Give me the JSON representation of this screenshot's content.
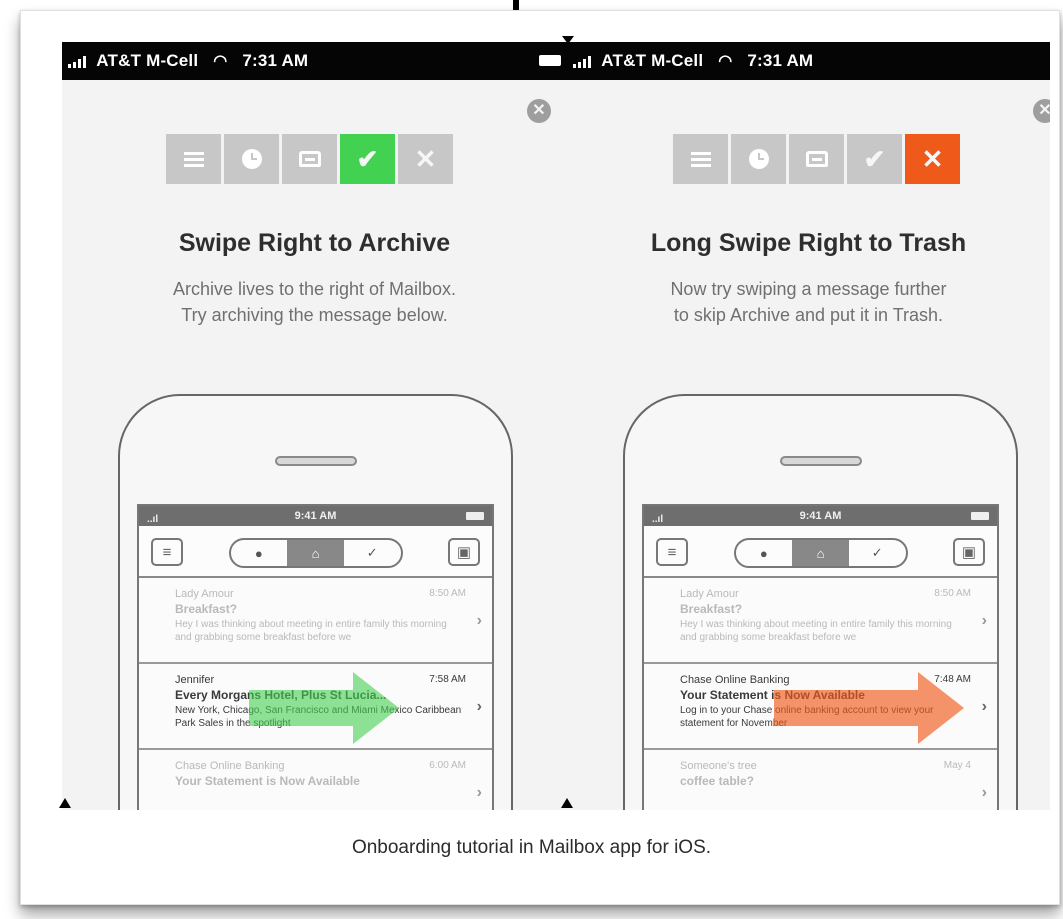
{
  "caption": "Onboarding tutorial in Mailbox app for iOS.",
  "status_bar": {
    "carrier": "AT&T M-Cell",
    "time": "7:31 AM"
  },
  "screens": [
    {
      "title": "Swipe Right to Archive",
      "line1": "Archive lives to the right of Mailbox.",
      "line2": "Try archiving the message below.",
      "active_action": "archive",
      "accent": "#43d151"
    },
    {
      "title": "Long Swipe Right to Trash",
      "line1": "Now try swiping a message further",
      "line2": "to skip Archive and put it in Trash.",
      "active_action": "trash",
      "accent": "#ef5a1b"
    }
  ],
  "icons": [
    "list-icon",
    "clock-icon",
    "inbox-icon",
    "check-icon",
    "x-icon",
    "close-icon"
  ],
  "phone": {
    "time": "9:41 AM",
    "left": {
      "msg1": {
        "from": "Lady Amour",
        "time": "8:50 AM",
        "subject": "Breakfast?",
        "preview": "Hey I was thinking about meeting in entire family this morning and grabbing some breakfast before we"
      },
      "msg2": {
        "from": "Jennifer",
        "time": "7:58 AM",
        "subject": "Every Morgans Hotel, Plus St Lucia...",
        "preview": "New York, Chicago, San Francisco and Miami Mexico Caribbean Park Sales in the spotlight"
      },
      "msg3": {
        "from": "Chase Online Banking",
        "time": "6:00 AM",
        "subject": "Your Statement is Now Available",
        "preview": ""
      }
    },
    "right": {
      "msg1": {
        "from": "Lady Amour",
        "time": "8:50 AM",
        "subject": "Breakfast?",
        "preview": "Hey I was thinking about meeting in entire family this morning and grabbing some breakfast before we"
      },
      "msg2": {
        "from": "Chase Online Banking",
        "time": "7:48 AM",
        "subject": "Your Statement is Now Available",
        "preview": "Log in to your Chase online banking account to view your statement for November"
      },
      "msg3": {
        "from": "Someone's tree",
        "time": "May 4",
        "subject": "coffee table?",
        "preview": ""
      }
    }
  }
}
